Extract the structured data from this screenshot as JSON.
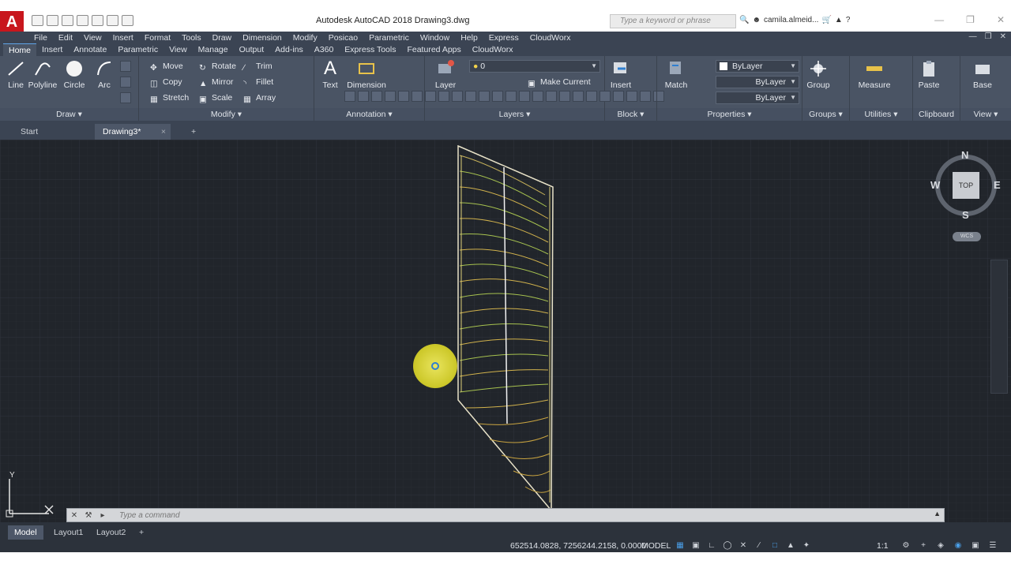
{
  "app": {
    "logo": "A",
    "title": "Autodesk AutoCAD 2018   Drawing3.dwg",
    "search_placeholder": "Type a keyword or phrase",
    "user": "camila.almeid...",
    "accent": "#c8161d"
  },
  "menubar": {
    "items": [
      "File",
      "Edit",
      "View",
      "Insert",
      "Format",
      "Tools",
      "Draw",
      "Dimension",
      "Modify",
      "Posicao",
      "Parametric",
      "Window",
      "Help",
      "Express",
      "CloudWorx"
    ]
  },
  "ribbon_tabs": {
    "items": [
      "Home",
      "Insert",
      "Annotate",
      "Parametric",
      "View",
      "Manage",
      "Output",
      "Add-ins",
      "A360",
      "Express Tools",
      "Featured Apps",
      "CloudWorx"
    ],
    "active": "Home"
  },
  "ribbon": {
    "draw": {
      "title": "Draw",
      "line": "Line",
      "polyline": "Polyline",
      "circle": "Circle",
      "arc": "Arc"
    },
    "modify": {
      "title": "Modify",
      "move": "Move",
      "rotate": "Rotate",
      "trim": "Trim",
      "copy": "Copy",
      "mirror": "Mirror",
      "fillet": "Fillet",
      "stretch": "Stretch",
      "scale": "Scale",
      "array": "Array"
    },
    "annotation": {
      "title": "Annotation",
      "text": "Text",
      "dimension": "Dimension"
    },
    "layers": {
      "title": "Layers",
      "layer": "Layer",
      "current_layer": "0",
      "make_current": "Make Current"
    },
    "block": {
      "title": "Block",
      "insert": "Insert"
    },
    "properties": {
      "title": "Properties",
      "match": "Match",
      "color": "ByLayer",
      "linetype": "ByLayer",
      "lineweight": "ByLayer"
    },
    "groups": {
      "title": "Groups",
      "group": "Group"
    },
    "utilities": {
      "title": "Utilities",
      "measure": "Measure"
    },
    "clipboard": {
      "title": "Clipboard",
      "paste": "Paste"
    },
    "view": {
      "title": "View",
      "base": "Base"
    }
  },
  "doc_tabs": {
    "start": "Start",
    "active": "Drawing3*",
    "close": "×",
    "add": "+"
  },
  "viewcube": {
    "north": "N",
    "south": "S",
    "east": "E",
    "west": "W",
    "top": "TOP",
    "wcs": "WCS"
  },
  "ucs": {
    "y": "Y"
  },
  "command_line": {
    "placeholder": "Type a command"
  },
  "layout_tabs": {
    "items": [
      "Model",
      "Layout1",
      "Layout2"
    ],
    "add": "+"
  },
  "statusbar": {
    "coords": "652514.0828, 7256244.2158, 0.0000",
    "space": "MODEL",
    "scale": "1:1"
  }
}
